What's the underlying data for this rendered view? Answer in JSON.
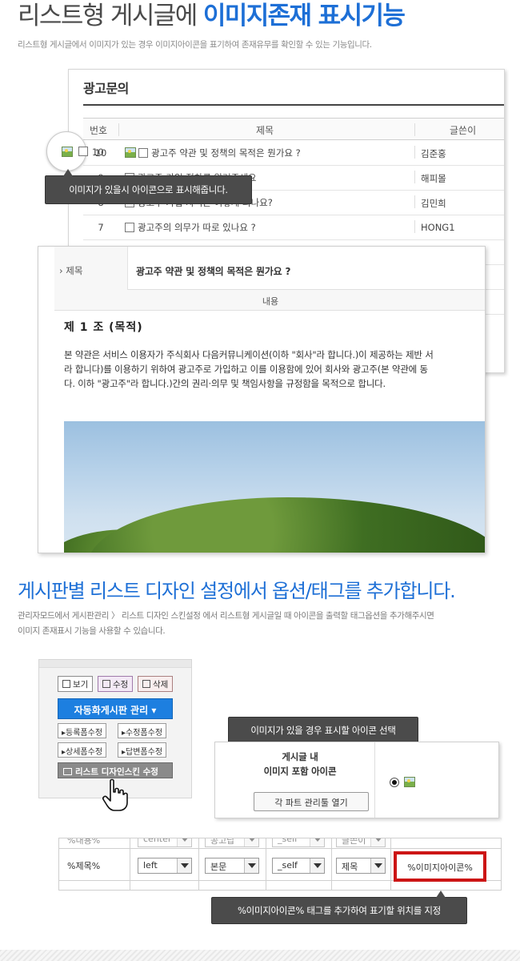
{
  "header": {
    "title_plain": "리스트형 게시글에 ",
    "title_accent": "이미지존재 표시기능",
    "description": "리스트형 게시글에서 이미지가 있는 경우 이미지아이콘을 표기하여 존재유무를 확인할 수 있는 기능입니다."
  },
  "board": {
    "title": "광고문의",
    "columns": {
      "number": "번호",
      "subject": "제목",
      "author": "글쓴이"
    },
    "rows": [
      {
        "number": "10",
        "subject": "광고주 약관 및 정책의 목적은 뭔가요 ?",
        "author": "김준홍",
        "has_image": true
      },
      {
        "number": "9",
        "subject": "광고주 가입 절차를 알려주세요",
        "author": "해피몰",
        "has_image": false
      },
      {
        "number": "8",
        "subject": "광고주 가입 자격은 어떻게 되나요?",
        "author": "김민희",
        "has_image": false
      },
      {
        "number": "7",
        "subject": "광고주의 의무가 따로 있나요 ?",
        "author": "HONG1",
        "has_image": false
      }
    ],
    "icon_name": "image-icon"
  },
  "tooltips": {
    "image_icon_tip": "이미지가 있을시 아이콘으로 표시해줍니다.",
    "icon_select_tip": "이미지가 있을 경우 표시할 아이콘 선택",
    "tag_tip": "%이미지아이콘% 태그를 추가하여 표기할 위치를 지정"
  },
  "post": {
    "subject_label": "› 제목",
    "subject": "광고주 약관 및 정책의 목적은 뭔가요 ?",
    "content_label": "내용",
    "heading": "제 1 조 (목적)",
    "body": "본 약관은 서비스 이용자가 주식회사 다음커뮤니케이션(이하 \"회사\"라 합니다.)이 제공하는 제반 서\n라 합니다)를 이용하기 위하여 광고주로 가입하고 이를 이용함에 있어 회사와 광고주(본 약관에 동\n다. 이하 \"광고주\"라 합니다.)간의 권리·의무 및 책임사항을 규정함을 목적으로 합니다."
  },
  "section2": {
    "title": "게시판별 리스트 디자인 설정에서 옵션/태그를 추가합니다.",
    "description": "관리자모드에서 게시판관리 〉 리스트 디자인 스킨설정 에서 리스트형 게시글일 때 아이콘을 출력할 태그옵션을 추가해주시면\n이미지 존재표시 기능을 사용할 수 있습니다."
  },
  "admin": {
    "view": "보기",
    "edit": "수정",
    "delete": "삭제",
    "auto_board": "자동화게시판 관리 ▾",
    "register_form": "등록폼수정",
    "edit_form": "수정폼수정",
    "detail_form": "상세폼수정",
    "reply_form": "답변폼수정",
    "list_design": "리스트 디자인스킨 수정"
  },
  "icon_select": {
    "label_line1": "게시글 내",
    "label_line2": "이미지 포함 아이콘",
    "open_parts": "각 파트 관리툴 열기"
  },
  "settings": {
    "top_row": [
      "%내용%",
      "center",
      "공고답",
      "_self",
      "글쓴이"
    ],
    "row": {
      "field": "%제목%",
      "align": "left",
      "type": "본문",
      "target": "_self",
      "label": "제목",
      "tag": "%이미지아이콘%"
    }
  },
  "colors": {
    "accent": "#1d6fd6",
    "tooltip_bg": "#4b4b4b",
    "highlight_red": "#cc1515",
    "auto_button": "#1d7fe0"
  }
}
